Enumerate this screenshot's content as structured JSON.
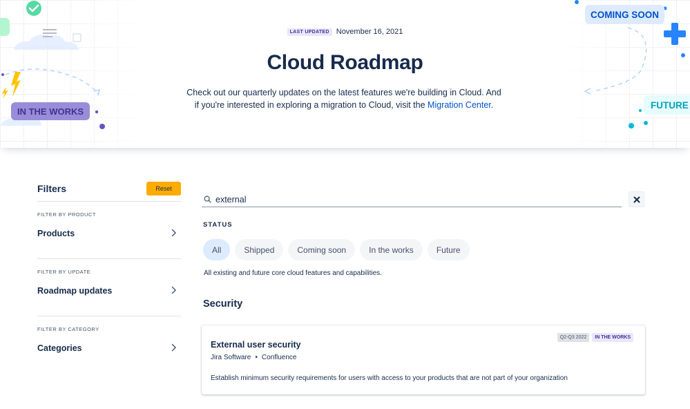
{
  "hero": {
    "last_updated_label": "LAST UPDATED",
    "last_updated_date": "November 16, 2021",
    "title": "Cloud Roadmap",
    "description_1": "Check out our quarterly updates on the latest features we're building in Cloud. And if you're interested in exploring a migration to Cloud, visit the",
    "migration_link": "Migration Center",
    "description_end": ".",
    "tag_in_the_works": "IN THE WORKS",
    "tag_coming_soon": "COMING SOON",
    "tag_future": "FUTURE",
    "colors": {
      "in_the_works_bg": "#8777d9",
      "coming_soon_bg": "#deebff",
      "future_bg": "#e6fcff",
      "accent_blue": "#2684ff",
      "accent_green": "#57d9a3",
      "accent_yellow": "#ffc400"
    }
  },
  "sidebar": {
    "title": "Filters",
    "reset_label": "Reset",
    "groups": [
      {
        "label": "FILTER BY PRODUCT",
        "value": "Products"
      },
      {
        "label": "FILTER BY UPDATE",
        "value": "Roadmap updates"
      },
      {
        "label": "FILTER BY CATEGORY",
        "value": "Categories"
      }
    ]
  },
  "main": {
    "search_value": "external",
    "status_label": "STATUS",
    "pills": [
      "All",
      "Shipped",
      "Coming soon",
      "In the works",
      "Future"
    ],
    "active_pill": "All",
    "pill_description": "All existing and future core cloud features and capabilities.",
    "section_title": "Security",
    "card": {
      "title": "External user security",
      "products": [
        "Jira Software",
        "Confluence"
      ],
      "separator": "•",
      "description": "Establish minimum security requirements for users with access to your products that are not part of your organization",
      "quarter_badge": "Q2-Q3 2022",
      "status_badge": "IN THE WORKS"
    }
  }
}
